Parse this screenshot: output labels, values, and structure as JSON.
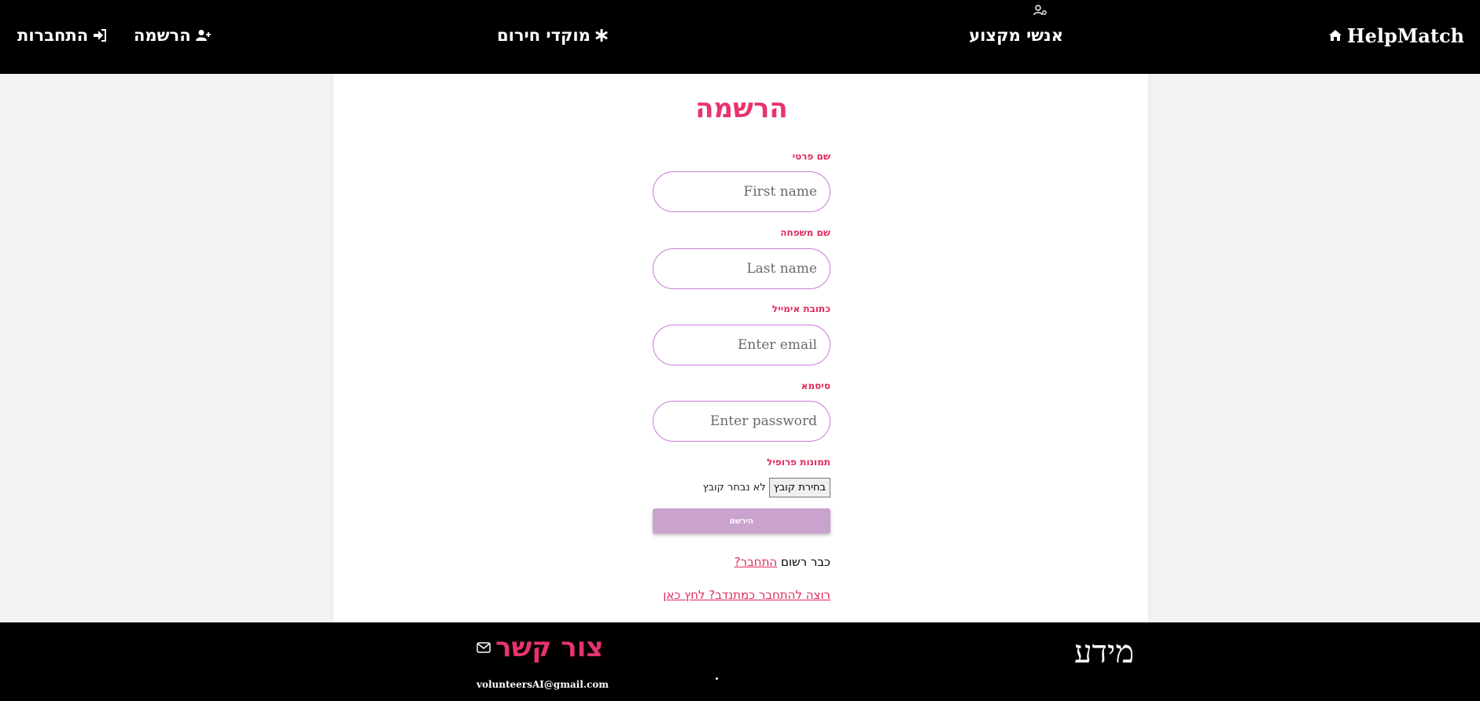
{
  "navbar": {
    "brand": "HelpMatch",
    "professionals": "אנשי מקצוע",
    "emergency": "מוקדי חירום",
    "register": "הרשמה",
    "login": "התחברות"
  },
  "form": {
    "title": "הרשמה",
    "first_name": {
      "label": "שם פרטי",
      "placeholder": "First name"
    },
    "last_name": {
      "label": "שם משפחה",
      "placeholder": "Last name"
    },
    "email": {
      "label": "כתובת אימייל",
      "placeholder": "Enter email"
    },
    "password": {
      "label": "סיסמא",
      "placeholder": "Enter password"
    },
    "profile_picture": {
      "label": "תמונות פרופיל",
      "button": "בחירת קובץ",
      "status": "לא נבחר קובץ"
    },
    "submit": "הירשם",
    "already_registered": "כבר רשום",
    "login_link": "התחבר?",
    "volunteer_link": "רוצה להתחבר כמתנדב? לחץ כאן"
  },
  "footer": {
    "info_title": "מידע",
    "contact_title": "צור קשר",
    "email": "volunteersAI@gmail.com"
  },
  "colors": {
    "accent": "#e8336c",
    "input_border": "#c97ad6",
    "submit_bg": "#c9a2cd"
  }
}
